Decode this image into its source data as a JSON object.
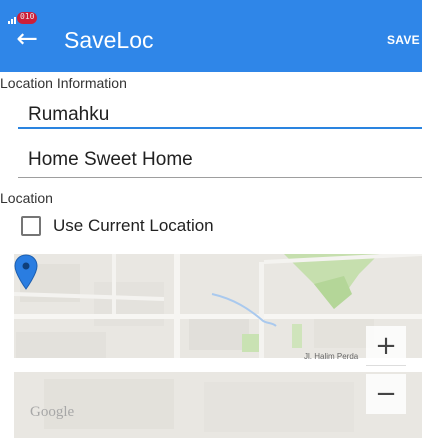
{
  "status_bar": {
    "sim_label": "010"
  },
  "appbar": {
    "back_icon": "back-arrow-icon",
    "title": "SaveLoc",
    "save_label": "SAVE",
    "color": "#2f86e8"
  },
  "location_info": {
    "heading": "Location Information",
    "name_value": "Rumahku",
    "description_value": "Home Sweet Home"
  },
  "location": {
    "heading": "Location",
    "use_current_label": "Use Current Location",
    "use_current_checked": false
  },
  "map": {
    "street_label": "Jl. Halim Perda",
    "attribution": "Google",
    "zoom_in_glyph": "+",
    "zoom_out_glyph": "−",
    "pin_color": "#2a7de1"
  }
}
